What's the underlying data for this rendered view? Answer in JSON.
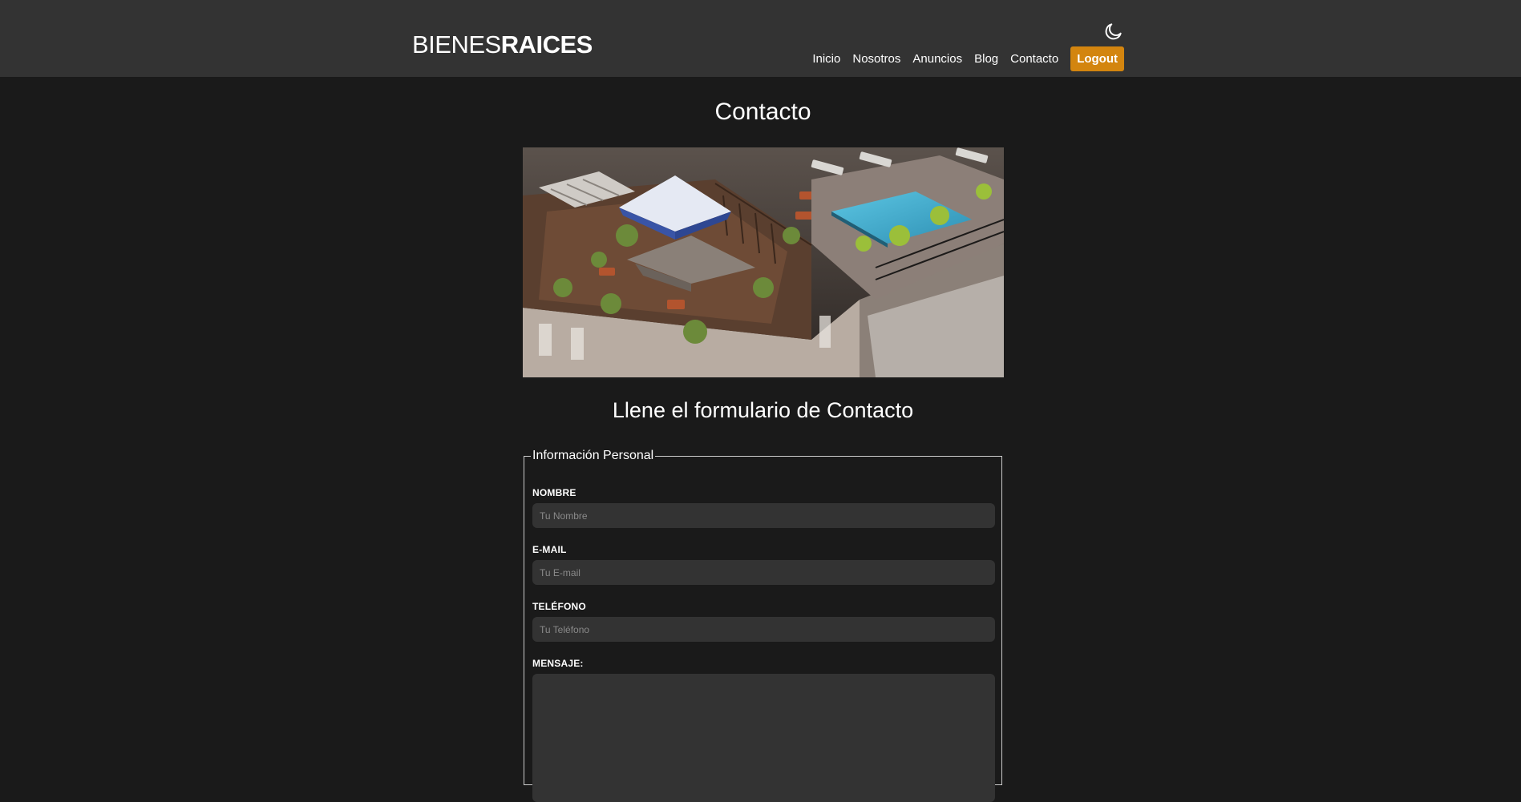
{
  "header": {
    "logo_light": "BIENES",
    "logo_bold": "RAICES",
    "nav": [
      "Inicio",
      "Nosotros",
      "Anuncios",
      "Blog",
      "Contacto"
    ],
    "logout": "Logout",
    "theme_icon": "moon-icon"
  },
  "main": {
    "title": "Contacto",
    "hero_image": "rooftop-terrace-pool-photo",
    "form_title": "Llene el formulario de Contacto"
  },
  "form": {
    "legend": "Información Personal",
    "fields": [
      {
        "label": "Nombre",
        "placeholder": "Tu Nombre"
      },
      {
        "label": "E-mail",
        "placeholder": "Tu E-mail"
      },
      {
        "label": "Teléfono",
        "placeholder": "Tu Teléfono"
      },
      {
        "label": "Mensaje:",
        "placeholder": ""
      }
    ]
  },
  "colors": {
    "background": "#1a1a1a",
    "header": "#333333",
    "accent": "#d3850f",
    "input": "#333333"
  }
}
